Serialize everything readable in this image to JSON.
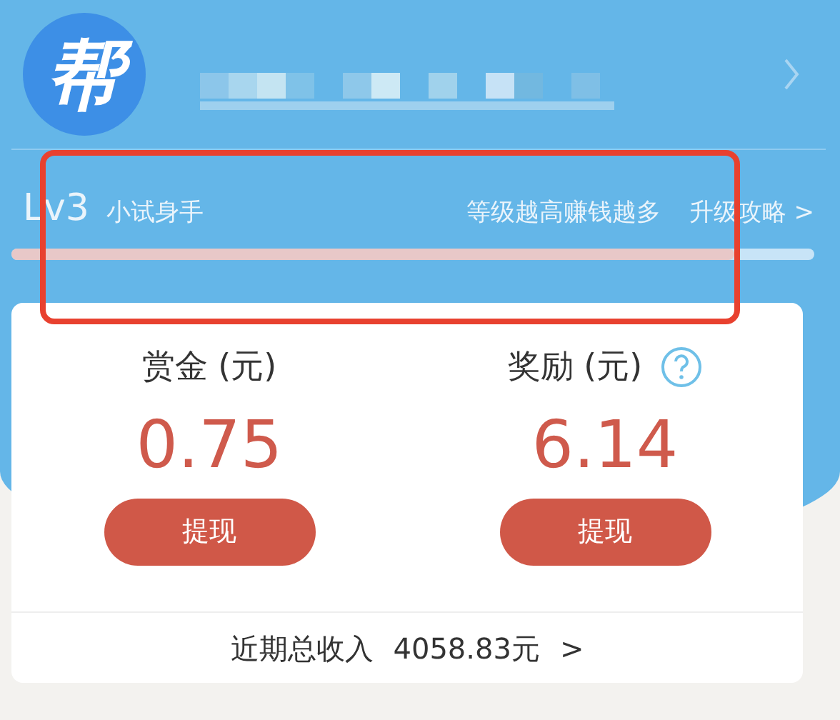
{
  "header": {
    "logo": "帮"
  },
  "level": {
    "badge": "Lv3",
    "title": "小试身手",
    "hint": "等级越高赚钱越多",
    "link": "升级攻略 >",
    "level": 0.9
  },
  "balances": [
    {
      "label": "赏金 (元)",
      "amount": "0.75",
      "button": "提现",
      "help": false
    },
    {
      "label": "奖励 (元)",
      "amount": "6.14",
      "button": "提现",
      "help": true
    }
  ],
  "total": {
    "label": "近期总收入",
    "amount": "4058.83元",
    "arrow": ">"
  }
}
